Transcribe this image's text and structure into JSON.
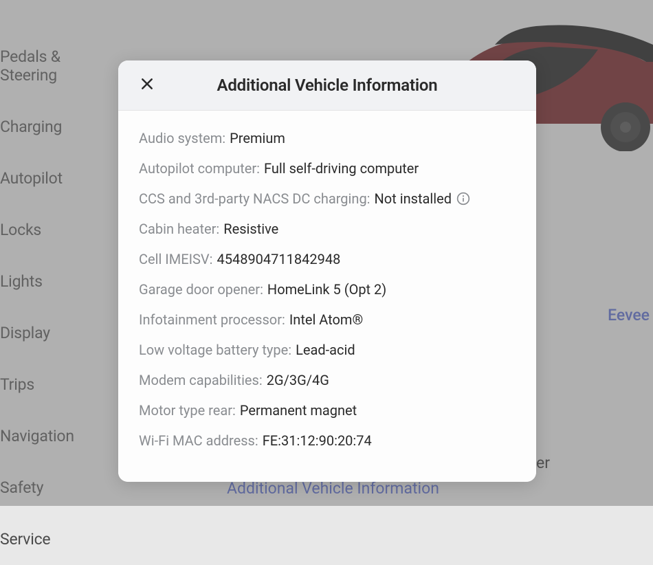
{
  "sidebar": {
    "items": [
      "Pedals & Steering",
      "Charging",
      "Autopilot",
      "Locks",
      "Lights",
      "Display",
      "Trips",
      "Navigation",
      "Safety",
      "Service"
    ]
  },
  "main": {
    "vehicle_name": "Eevee",
    "autopilot_computer_label": "Autopilot Computer:",
    "autopilot_computer_value": "Full self-driving computer",
    "additional_link": "Additional Vehicle Information"
  },
  "modal": {
    "title": "Additional Vehicle Information",
    "specs": [
      {
        "label": "Audio system:",
        "value": "Premium",
        "has_info": false
      },
      {
        "label": "Autopilot computer:",
        "value": "Full self-driving computer",
        "has_info": false
      },
      {
        "label": "CCS and 3rd-party NACS DC charging:",
        "value": "Not installed",
        "has_info": true
      },
      {
        "label": "Cabin heater:",
        "value": "Resistive",
        "has_info": false
      },
      {
        "label": "Cell IMEISV:",
        "value": "4548904711842948",
        "has_info": false
      },
      {
        "label": "Garage door opener:",
        "value": "HomeLink 5 (Opt 2)",
        "has_info": false
      },
      {
        "label": "Infotainment processor:",
        "value": "Intel Atom®",
        "has_info": false
      },
      {
        "label": "Low voltage battery type:",
        "value": "Lead-acid",
        "has_info": false
      },
      {
        "label": "Modem capabilities:",
        "value": "2G/3G/4G",
        "has_info": false
      },
      {
        "label": "Motor type rear:",
        "value": "Permanent magnet",
        "has_info": false
      },
      {
        "label": "Wi-Fi MAC address:",
        "value": "FE:31:12:90:20:74",
        "has_info": false
      }
    ]
  }
}
